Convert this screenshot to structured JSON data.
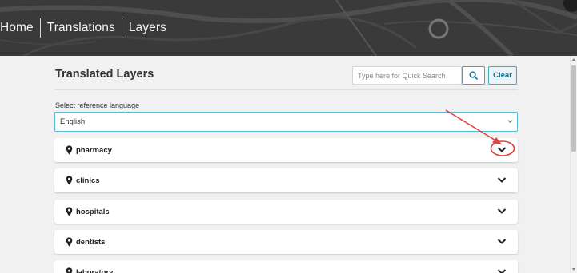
{
  "breadcrumb": {
    "items": [
      {
        "label": "Home"
      },
      {
        "label": "Translations"
      },
      {
        "label": "Layers"
      }
    ]
  },
  "page": {
    "title": "Translated Layers"
  },
  "search": {
    "placeholder": "Type here for Quick Search",
    "value": "",
    "button_icon": "search-icon",
    "clear_label": "Clear"
  },
  "reference_language": {
    "label": "Select reference language",
    "selected": "English"
  },
  "layers": [
    {
      "name": "pharmacy",
      "icon": "map-pin-icon",
      "expand_icon": "chevron-down-icon",
      "highlighted": true
    },
    {
      "name": "clinics",
      "icon": "map-pin-icon",
      "expand_icon": "chevron-down-icon"
    },
    {
      "name": "hospitals",
      "icon": "map-pin-icon",
      "expand_icon": "chevron-down-icon"
    },
    {
      "name": "dentists",
      "icon": "map-pin-icon",
      "expand_icon": "chevron-down-icon"
    },
    {
      "name": "laboratory",
      "icon": "map-pin-icon",
      "expand_icon": "chevron-down-icon"
    }
  ],
  "colors": {
    "accent": "#41a6c4",
    "annotation": "#e0413c",
    "header_bg": "#3b3b3b"
  }
}
